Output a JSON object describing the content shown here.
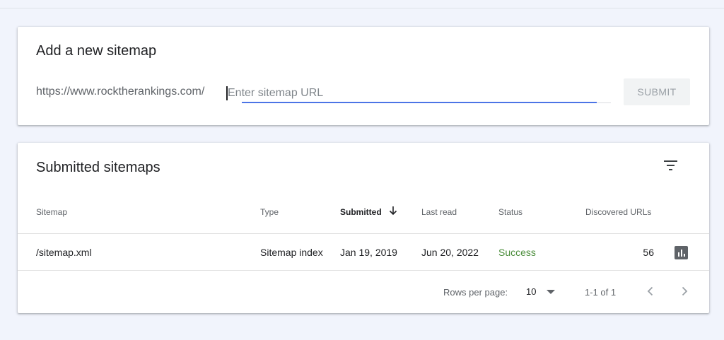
{
  "add_sitemap": {
    "title": "Add a new sitemap",
    "url_prefix": "https://www.rocktherankings.com/",
    "input_placeholder": "Enter sitemap URL",
    "input_value": "",
    "submit_label": "SUBMIT"
  },
  "submitted": {
    "title": "Submitted sitemaps",
    "columns": {
      "sitemap": "Sitemap",
      "type": "Type",
      "submitted": "Submitted",
      "last_read": "Last read",
      "status": "Status",
      "discovered": "Discovered URLs"
    },
    "sort_column": "Submitted",
    "sort_direction": "descending",
    "rows": [
      {
        "sitemap": "/sitemap.xml",
        "type": "Sitemap index",
        "submitted": "Jan 19, 2019",
        "last_read": "Jun 20, 2022",
        "status": "Success",
        "discovered": "56"
      }
    ],
    "pagination": {
      "rows_per_page_label": "Rows per page:",
      "rows_per_page": "10",
      "range": "1-1 of 1"
    }
  },
  "colors": {
    "accent": "#4c74e6",
    "success": "#4b8d3b",
    "page_background": "#f1f4fc"
  },
  "icons": [
    "filter-icon",
    "sort-arrow-down-icon",
    "report-icon",
    "dropdown-arrow-icon",
    "chevron-left-icon",
    "chevron-right-icon"
  ]
}
